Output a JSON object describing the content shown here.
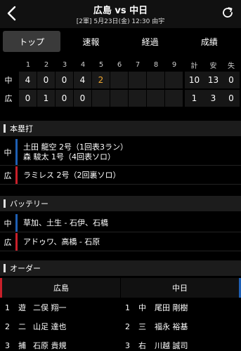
{
  "header": {
    "title": "広島 vs 中日",
    "subtitle": "[2軍] 5月23日(金) 12:30 由宇",
    "back_icon": "chevron-left-icon",
    "refresh_icon": "refresh-icon"
  },
  "tabs": [
    {
      "label": "トップ",
      "active": true
    },
    {
      "label": "速報",
      "active": false
    },
    {
      "label": "経過",
      "active": false
    },
    {
      "label": "成績",
      "active": false
    }
  ],
  "scoreboard": {
    "innings_header": [
      "1",
      "2",
      "3",
      "4",
      "5",
      "6",
      "7",
      "8",
      "9"
    ],
    "totals_header": [
      "計",
      "安",
      "失"
    ],
    "rows": [
      {
        "team": "中",
        "innings": [
          "4",
          "0",
          "0",
          "4",
          "2",
          "",
          "",
          "",
          ""
        ],
        "totals": [
          "10",
          "13",
          "0"
        ]
      },
      {
        "team": "広",
        "innings": [
          "0",
          "1",
          "0",
          "0",
          "",
          "",
          "",
          "",
          ""
        ],
        "totals": [
          "1",
          "3",
          "0"
        ]
      }
    ]
  },
  "homeruns": {
    "title": "本塁打",
    "rows": [
      {
        "team": "中",
        "lines": [
          "土田 龍空 2号（1回表3ラン）",
          "森 駿太 1号（4回表ソロ）"
        ]
      },
      {
        "team": "広",
        "lines": [
          "ラミレス 2号（2回裏ソロ）"
        ]
      }
    ]
  },
  "battery": {
    "title": "バッテリー",
    "rows": [
      {
        "team": "中",
        "text": "草加、土生 - 石伊、石橋"
      },
      {
        "team": "広",
        "text": "アドゥワ、高橋 - 石原"
      }
    ]
  },
  "order": {
    "title": "オーダー",
    "home_team": "広島",
    "away_team": "中日",
    "rows": [
      {
        "num": "1",
        "h_pos": "遊",
        "h_name": "二俣 翔一",
        "a_num": "1",
        "a_pos": "中",
        "a_name": "尾田 剛樹"
      },
      {
        "num": "2",
        "h_pos": "二",
        "h_name": "山足 達也",
        "a_num": "2",
        "a_pos": "三",
        "a_name": "福永 裕基"
      },
      {
        "num": "3",
        "h_pos": "捕",
        "h_name": "石原 貴規",
        "a_num": "3",
        "a_pos": "右",
        "a_name": "川越 誠司"
      }
    ]
  },
  "colors": {
    "chunichi": "#1e5fb4",
    "hiroshima": "#c8202a",
    "highlight": "#f0a830"
  }
}
